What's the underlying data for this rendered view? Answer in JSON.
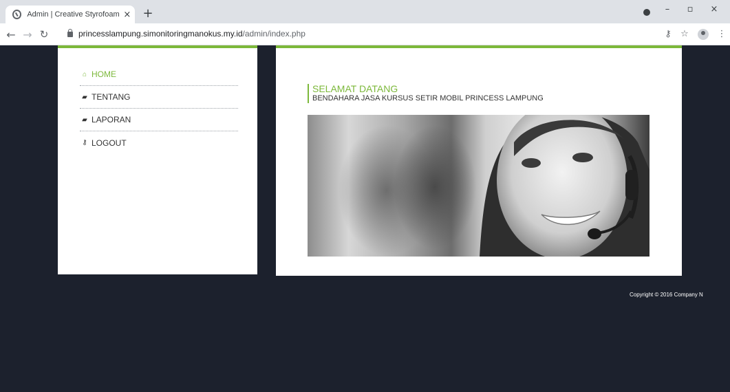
{
  "browser": {
    "tab_title": "Admin | Creative Styrofoam",
    "tab_close": "×",
    "new_tab": "+",
    "url_host": "princesslampung.simonitoringmanokus.my.id",
    "url_path": "/admin/index.php",
    "controls": {
      "minimize": "–",
      "restore": "▫",
      "close": "×"
    }
  },
  "sidebar": {
    "items": [
      {
        "label": "HOME",
        "icon": "home-icon",
        "glyph": "⌂",
        "active": true
      },
      {
        "label": "TENTANG",
        "icon": "book-icon",
        "glyph": "▰",
        "active": false
      },
      {
        "label": "LAPORAN",
        "icon": "book-icon",
        "glyph": "▰",
        "active": false
      },
      {
        "label": "LOGOUT",
        "icon": "key-icon",
        "glyph": "⚷",
        "active": false
      }
    ]
  },
  "main": {
    "welcome_title": "SELAMAT DATANG",
    "welcome_subtitle": "BENDAHARA JASA KURSUS SETIR MOBIL PRINCESS LAMPUNG",
    "hero_image": "smiling woman with headset"
  },
  "footer": {
    "copyright": "Copyright © 2016 Company N"
  },
  "colors": {
    "accent": "#7cb83a",
    "page_bg": "#1c212d"
  }
}
